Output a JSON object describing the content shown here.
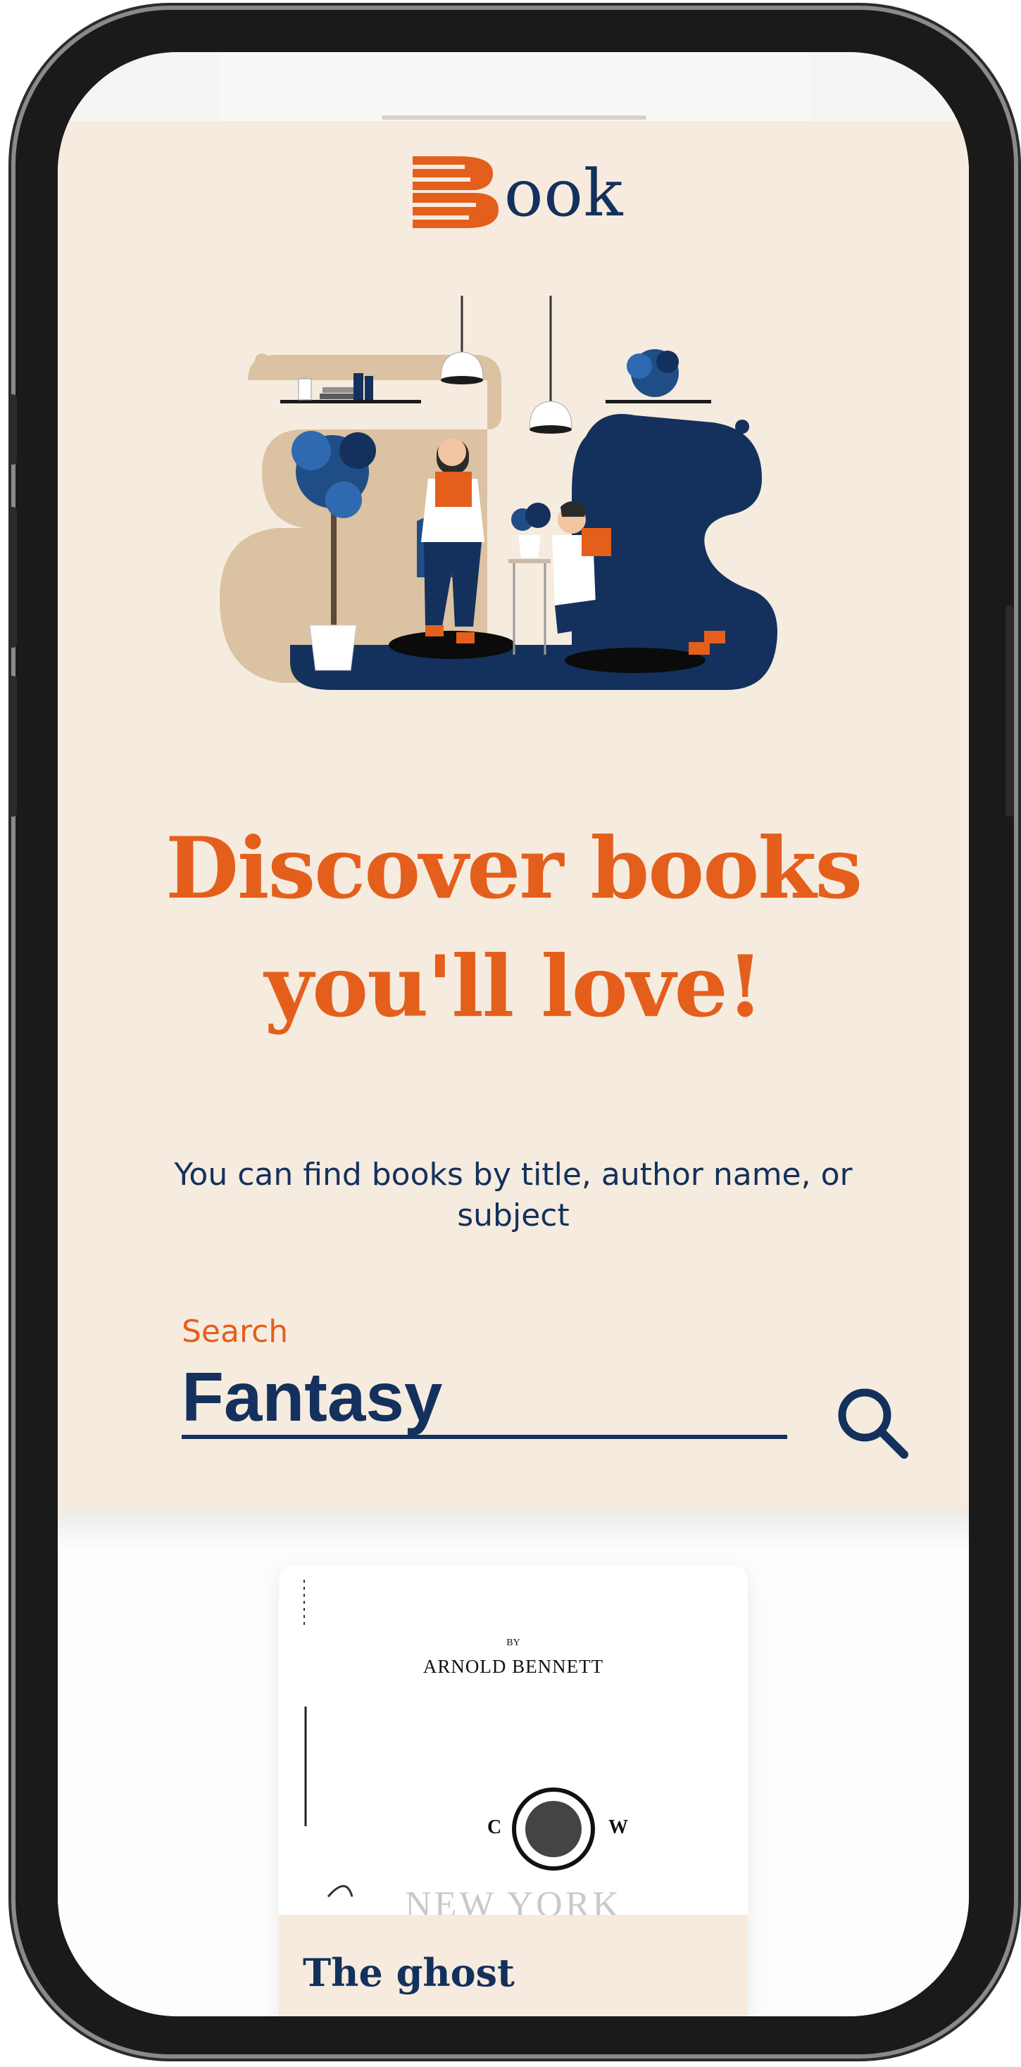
{
  "brand": {
    "logo_text": "ook",
    "accent_color": "#e45f1c",
    "primary_color": "#13315c",
    "background_color": "#f6ebde"
  },
  "hero": {
    "headline_line1": "Discover books",
    "headline_line2": "you'll love!",
    "subtitle": "You can find books by title, author name, or subject"
  },
  "search": {
    "label": "Search",
    "value": "Fantasy",
    "button_icon": "search-icon"
  },
  "results": {
    "books": [
      {
        "title": "The ghost",
        "cover_by": "BY",
        "cover_author": "ARNOLD BENNETT",
        "cover_city": "NEW YORK",
        "cover_mark_left": "C",
        "cover_mark_right": "W"
      }
    ]
  }
}
